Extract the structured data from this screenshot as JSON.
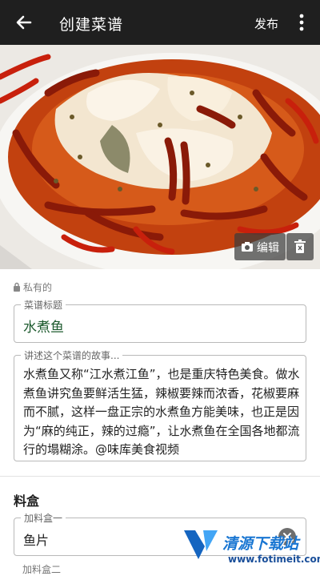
{
  "appbar": {
    "title": "创建菜谱",
    "publish_label": "发布"
  },
  "hero": {
    "edit_label": "编辑"
  },
  "privacy": {
    "label": "私有的"
  },
  "title_field": {
    "label": "菜谱标题",
    "value": "水煮鱼"
  },
  "story_field": {
    "label": "讲述这个菜谱的故事...",
    "value": "水煮鱼又称“江水煮江鱼”，也是重庆特色美食。做水煮鱼讲究鱼要鲜活生猛，辣椒要辣而浓香，花椒要麻而不腻，这样一盘正宗的水煮鱼方能美味，也正是因为“麻的纯正，辣的过瘾”，让水煮鱼在全国各地都流行的塌糊涂。@味库美食视频"
  },
  "ingredients": {
    "section_title": "料盒",
    "items": [
      {
        "label": "加料盒一",
        "value": "鱼片"
      },
      {
        "label": "加料盒二",
        "value": ""
      }
    ]
  },
  "watermark": {
    "text": "清源下载站",
    "url": "www.fotimeit.com"
  }
}
